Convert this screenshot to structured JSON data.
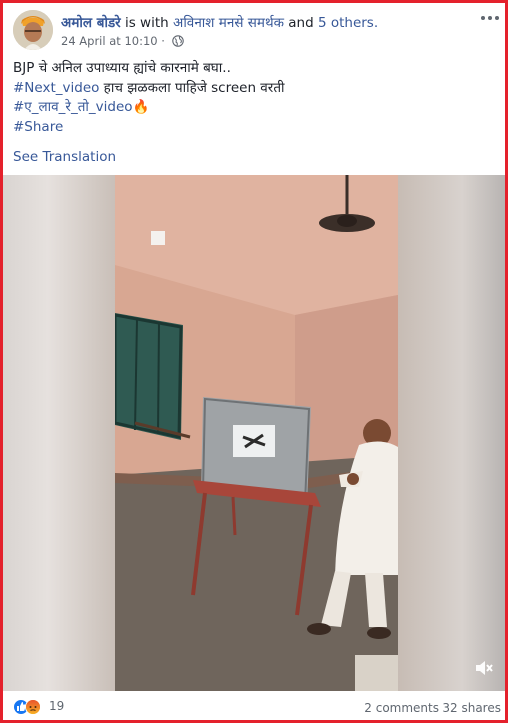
{
  "post": {
    "author": "अमोल बोडरे",
    "with_prefix": "is with",
    "with_person": "अविनाश मनसे समर्थक",
    "and_text": "and",
    "others": "5 others.",
    "timestamp": "24 April at 10:10 ·",
    "text_line1": "BJP चे अनिल उपाध्याय ह्यांचे कारनामे बघा..",
    "line2_tag": "#Next_video",
    "line2_rest": " हाच झळकला पाहिजे screen वरती",
    "line3_tag": "#ए_लाव_रे_तो_video",
    "line3_emoji": "🔥",
    "line4_tag": "#Share",
    "see_translation": "See Translation"
  },
  "footer": {
    "reaction_count": "19",
    "comments": "2 comments",
    "shares": "32 shares"
  },
  "icons": {
    "more": "ellipsis-icon",
    "privacy": "globe-icon",
    "mute": "volume-muted-icon",
    "like": "like-reaction-icon",
    "angry": "angry-reaction-icon"
  },
  "colors": {
    "link": "#385898",
    "frame": "#e4212c",
    "like": "#1877f2",
    "angry": "#f7b125"
  }
}
